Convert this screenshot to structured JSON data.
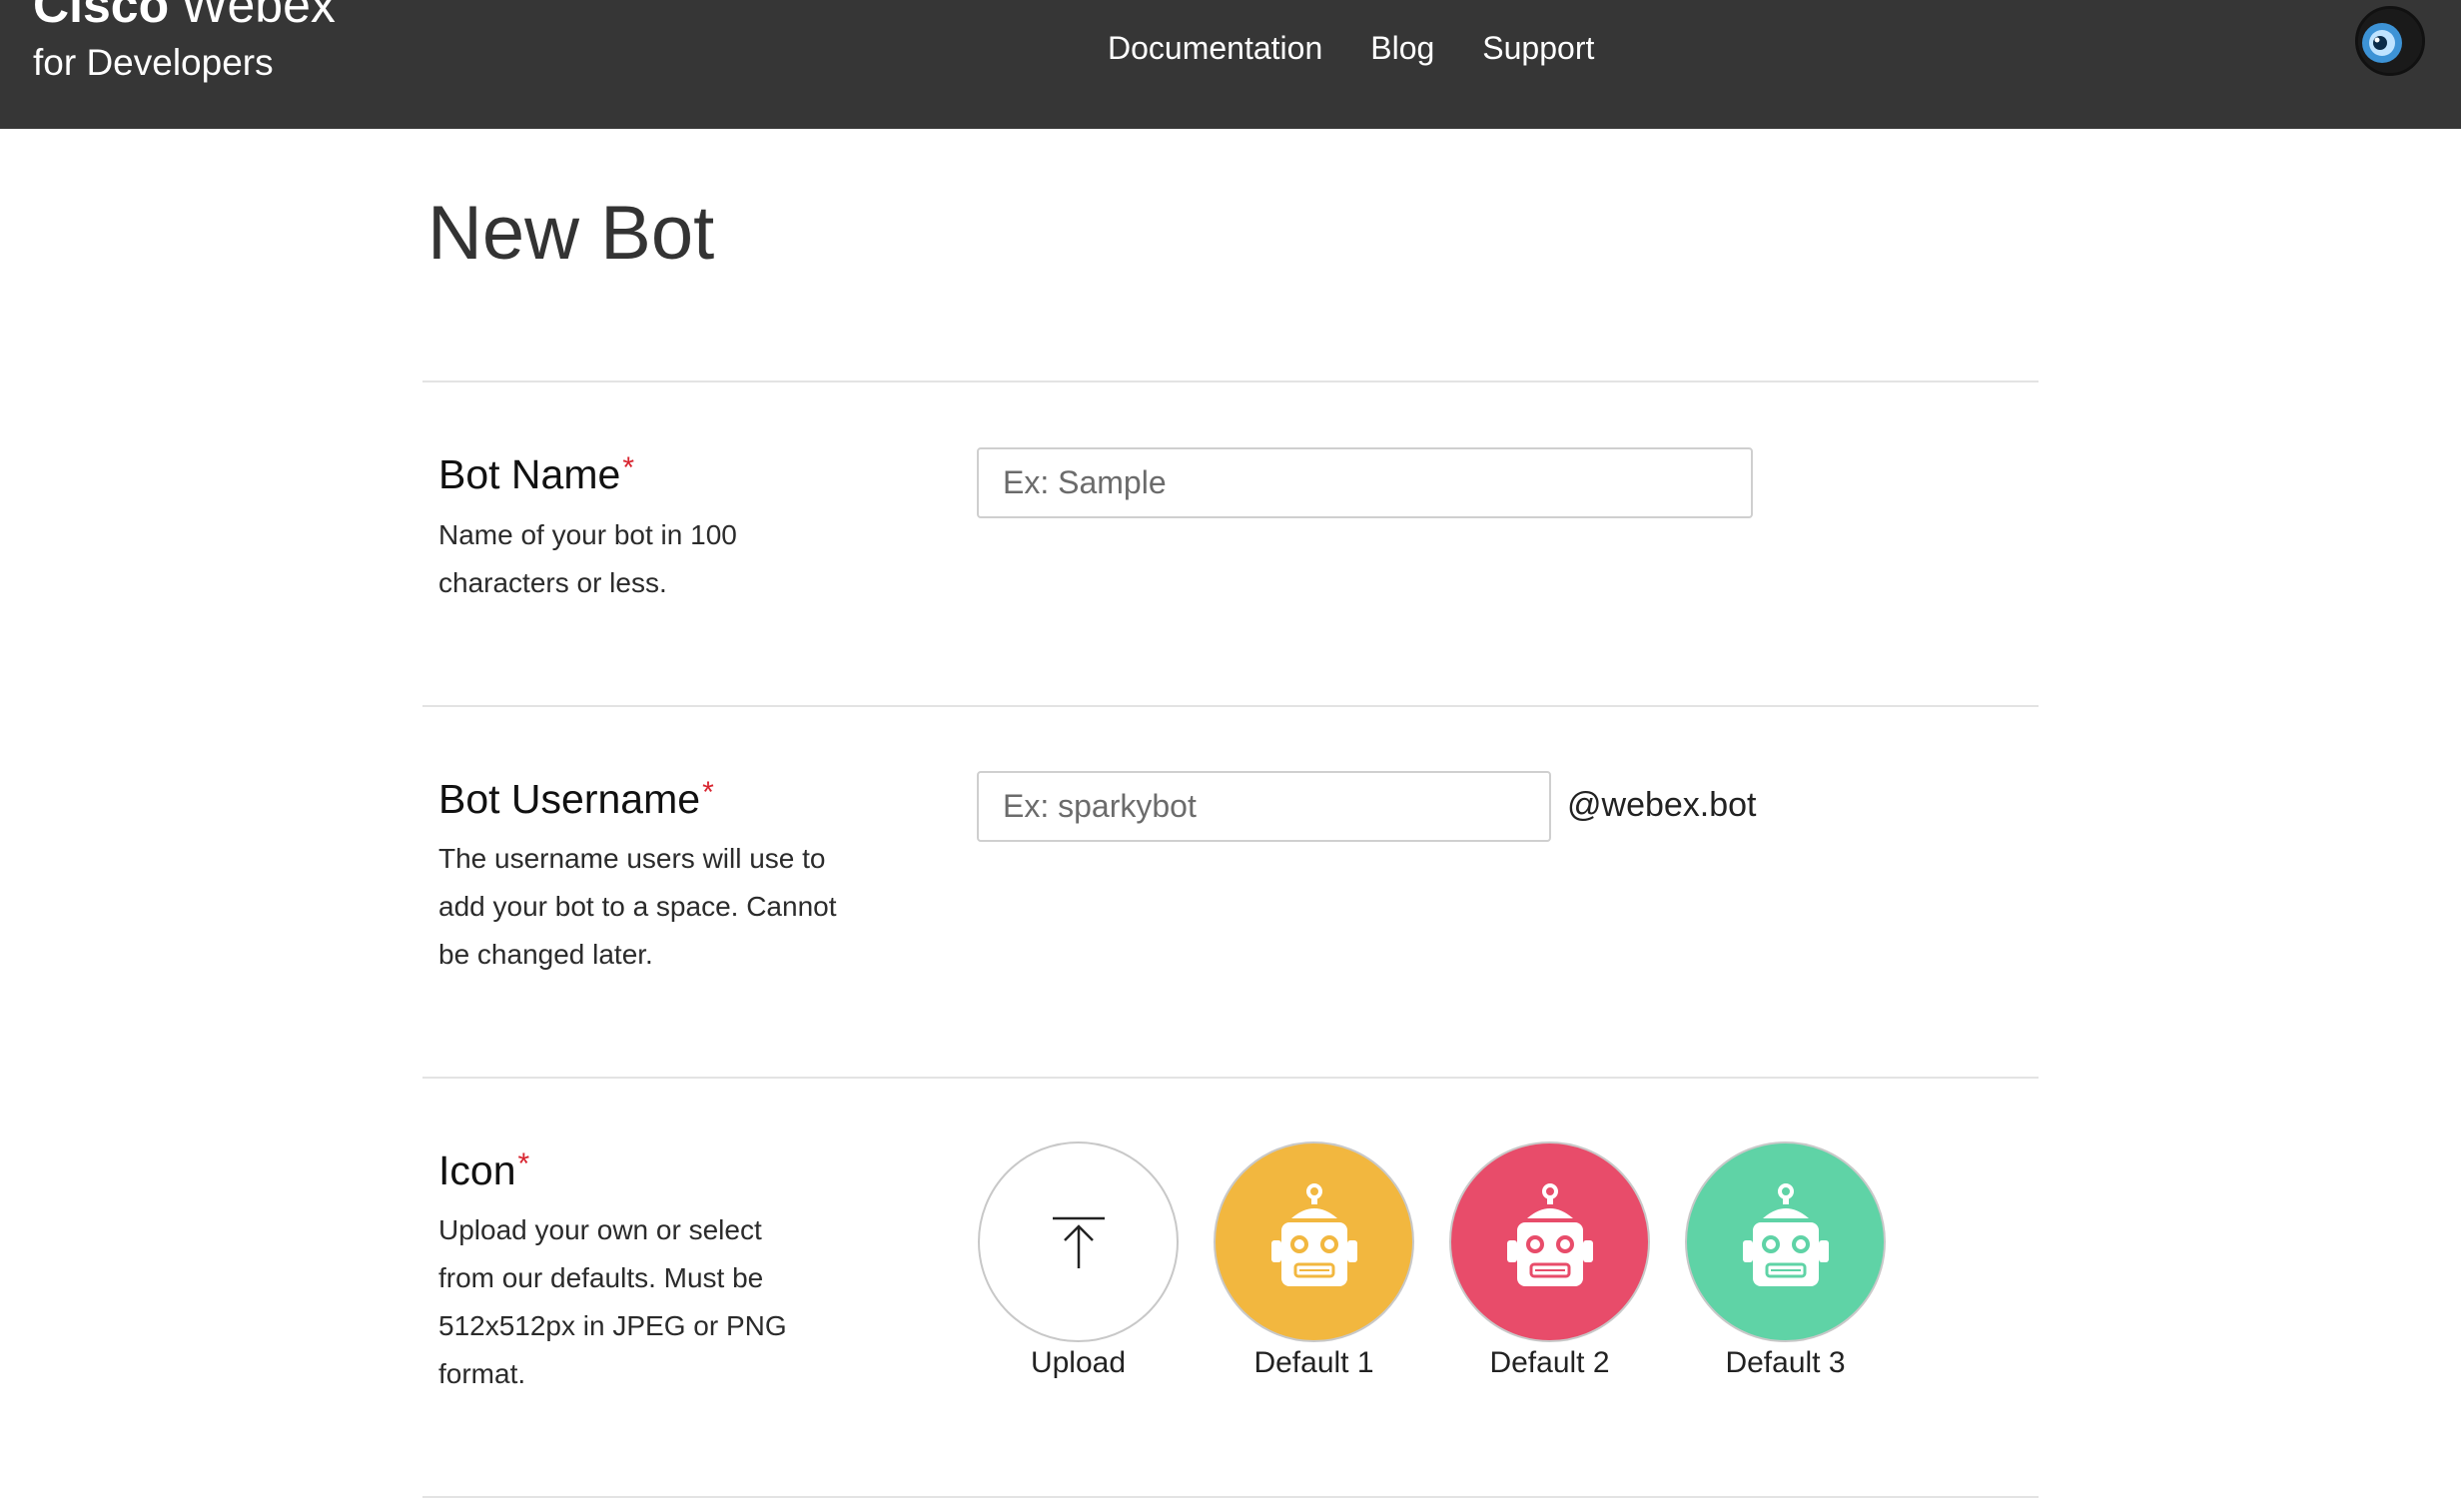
{
  "header": {
    "brand": {
      "company": "Cisco",
      "product": "Webex",
      "subtitle": "for Developers"
    },
    "nav": [
      {
        "label": "Documentation"
      },
      {
        "label": "Blog"
      },
      {
        "label": "Support"
      }
    ],
    "avatar_icon": "user-avatar"
  },
  "page": {
    "title": "New Bot"
  },
  "form": {
    "required_marker": "*",
    "bot_name": {
      "label": "Bot Name",
      "help": "Name of your bot in 100 characters or less.",
      "placeholder": "Ex: Sample",
      "value": ""
    },
    "bot_username": {
      "label": "Bot Username",
      "help": "The username users will use to add your bot to a space. Cannot be changed later.",
      "placeholder": "Ex: sparkybot",
      "value": "",
      "suffix": "@webex.bot"
    },
    "icon": {
      "label": "Icon",
      "help": "Upload your own or select from our defaults. Must be 512x512px in JPEG or PNG format.",
      "options": [
        {
          "label": "Upload",
          "icon": "upload-arrow-icon",
          "color": "#ffffff"
        },
        {
          "label": "Default 1",
          "icon": "robot-icon",
          "color": "#f2b73f"
        },
        {
          "label": "Default 2",
          "icon": "robot-icon",
          "color": "#e84c6a"
        },
        {
          "label": "Default 3",
          "icon": "robot-icon",
          "color": "#5fd3a6"
        }
      ]
    }
  },
  "colors": {
    "header_bg": "#363636",
    "required": "#d8242f",
    "divider": "#e3e3e3"
  }
}
